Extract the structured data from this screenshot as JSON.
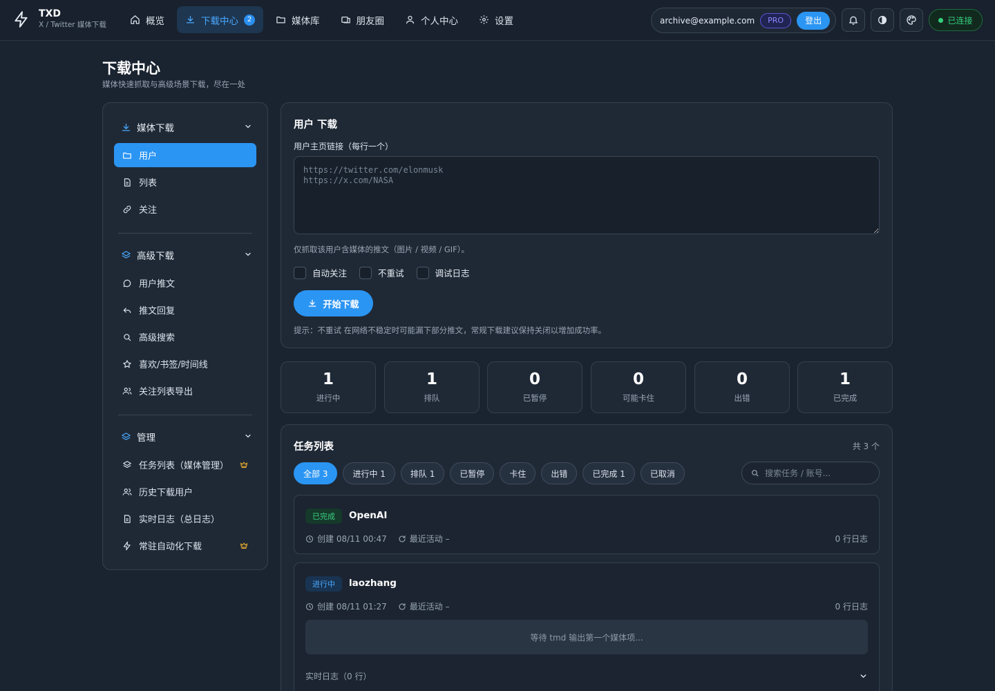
{
  "brand": {
    "name": "TXD",
    "subtitle": "X / Twitter 媒体下载"
  },
  "nav": {
    "items": [
      {
        "label": "概览",
        "icon": "home-icon"
      },
      {
        "label": "下载中心",
        "icon": "download-icon",
        "badge": "2",
        "active": true
      },
      {
        "label": "媒体库",
        "icon": "folder-icon"
      },
      {
        "label": "朋友圈",
        "icon": "group-icon"
      },
      {
        "label": "个人中心",
        "icon": "user-icon"
      },
      {
        "label": "设置",
        "icon": "gear-icon"
      }
    ]
  },
  "account": {
    "email": "archive@example.com",
    "plan": "PRO",
    "logout_label": "登出"
  },
  "connection": {
    "status": "已连接",
    "color": "#35d07f"
  },
  "page": {
    "title": "下载中心",
    "subtitle": "媒体快速抓取与高级场景下载，尽在一处"
  },
  "sidebar": {
    "groups": [
      {
        "label": "媒体下载",
        "icon": "download-icon",
        "items": [
          {
            "label": "用户",
            "icon": "folder-icon",
            "active": true
          },
          {
            "label": "列表",
            "icon": "document-icon"
          },
          {
            "label": "关注",
            "icon": "link-icon"
          }
        ]
      },
      {
        "label": "高级下载",
        "icon": "layers-icon",
        "items": [
          {
            "label": "用户推文",
            "icon": "chat-icon"
          },
          {
            "label": "推文回复",
            "icon": "reply-icon"
          },
          {
            "label": "高级搜索",
            "icon": "search-icon"
          },
          {
            "label": "喜欢/书签/时间线",
            "icon": "star-icon"
          },
          {
            "label": "关注列表导出",
            "icon": "users-icon"
          }
        ]
      },
      {
        "label": "管理",
        "icon": "layers-icon",
        "items": [
          {
            "label": "任务列表（媒体管理）",
            "icon": "layers-icon",
            "crown": true
          },
          {
            "label": "历史下载用户",
            "icon": "users-icon"
          },
          {
            "label": "实时日志（总日志）",
            "icon": "document-icon"
          },
          {
            "label": "常驻自动化下载",
            "icon": "bolt-icon",
            "crown": true
          }
        ]
      }
    ]
  },
  "user_download": {
    "title": "用户 下载",
    "field_label": "用户主页链接（每行一个）",
    "placeholder": "https://twitter.com/elonmusk\nhttps://x.com/NASA",
    "value": "",
    "hint": "仅抓取该用户含媒体的推文（图片 / 视频 / GIF）。",
    "options": [
      {
        "label": "自动关注",
        "checked": false
      },
      {
        "label": "不重试",
        "checked": false
      },
      {
        "label": "调试日志",
        "checked": false
      }
    ],
    "start_label": "开始下载",
    "tip": "提示：不重试 在网络不稳定时可能漏下部分推文，常规下载建议保持关闭以增加成功率。"
  },
  "stats": [
    {
      "value": "1",
      "label": "进行中"
    },
    {
      "value": "1",
      "label": "排队"
    },
    {
      "value": "0",
      "label": "已暂停"
    },
    {
      "value": "0",
      "label": "可能卡住"
    },
    {
      "value": "0",
      "label": "出错"
    },
    {
      "value": "1",
      "label": "已完成"
    }
  ],
  "tasks": {
    "title": "任务列表",
    "total": "共 3 个",
    "filters": [
      {
        "label": "全部 3",
        "active": true
      },
      {
        "label": "进行中 1"
      },
      {
        "label": "排队 1"
      },
      {
        "label": "已暂停"
      },
      {
        "label": "卡住"
      },
      {
        "label": "出错"
      },
      {
        "label": "已完成 1"
      },
      {
        "label": "已取消"
      }
    ],
    "search_placeholder": "搜索任务 / 账号...",
    "items": [
      {
        "status": "已完成",
        "status_kind": "done",
        "name": "OpenAI",
        "created": "创建 08/11 00:47",
        "activity": "最近活动 –",
        "logs": "0 行日志"
      },
      {
        "status": "进行中",
        "status_kind": "running",
        "name": "laozhang",
        "created": "创建 08/11 01:27",
        "activity": "最近活动 –",
        "logs": "0 行日志",
        "waiting": "等待 tmd 输出第一个媒体项...",
        "live_log": "实时日志（0 行）"
      }
    ]
  }
}
